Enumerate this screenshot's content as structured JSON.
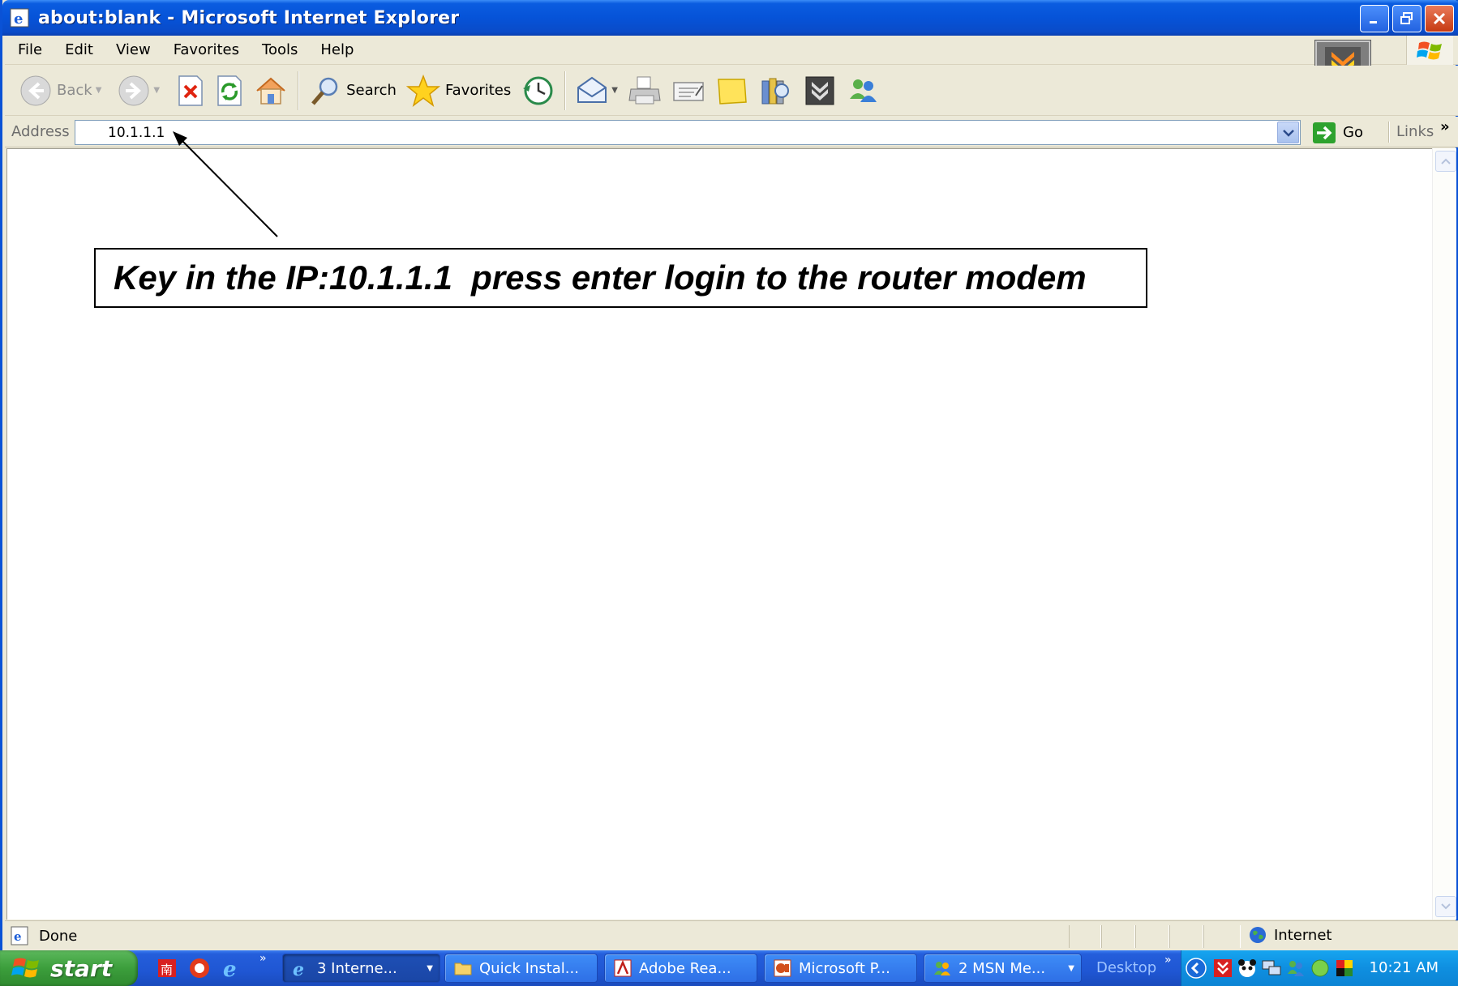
{
  "window": {
    "title": "about:blank - Microsoft Internet Explorer"
  },
  "menubar": {
    "items": [
      "File",
      "Edit",
      "View",
      "Favorites",
      "Tools",
      "Help"
    ]
  },
  "toolbar": {
    "back_label": "Back",
    "search_label": "Search",
    "favorites_label": "Favorites"
  },
  "address": {
    "label": "Address",
    "value": "10.1.1.1",
    "go_label": "Go",
    "links_label": "Links"
  },
  "content": {
    "callout": "Key in the IP:10.1.1.1  press enter login to the router modem"
  },
  "status": {
    "text": "Done",
    "zone": "Internet"
  },
  "taskbar": {
    "start_label": "start",
    "tasks": [
      {
        "label": "3 Interne...",
        "icon": "ie-icon",
        "active": true
      },
      {
        "label": "Quick Instal...",
        "icon": "folder-icon",
        "active": false
      },
      {
        "label": "Adobe Rea...",
        "icon": "adobe-reader-icon",
        "active": false
      },
      {
        "label": "Microsoft P...",
        "icon": "powerpoint-icon",
        "active": false
      },
      {
        "label": "2 MSN Me...",
        "icon": "msn-messenger-icon",
        "active": false
      }
    ],
    "desktop_label": "Desktop",
    "clock": "10:21 AM"
  },
  "colors": {
    "titlebar": "#0653d8",
    "taskbar": "#245edb",
    "start": "#3c9e3c",
    "tray": "#0f8fe0"
  }
}
